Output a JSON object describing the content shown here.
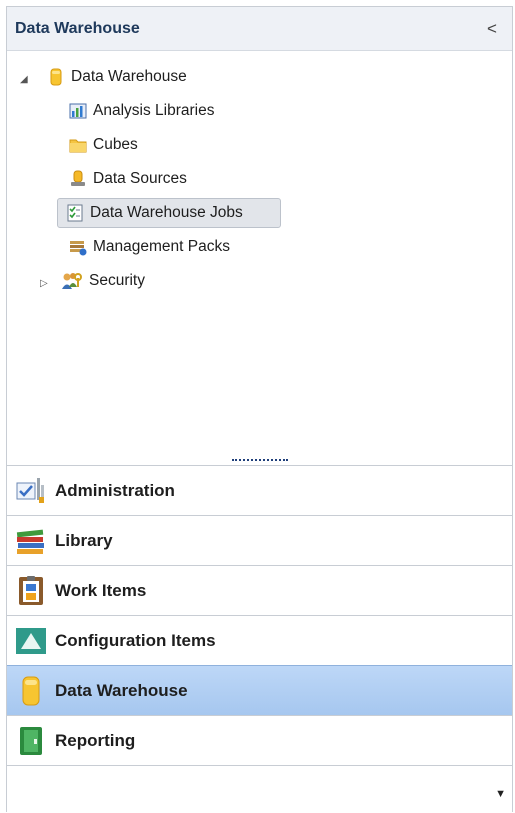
{
  "header": {
    "title": "Data Warehouse",
    "collapse_glyph": "<"
  },
  "tree": {
    "root": {
      "label": "Data Warehouse",
      "icon": "database-icon",
      "expanded": true,
      "twisty": "◢"
    },
    "children": [
      {
        "label": "Analysis Libraries",
        "icon": "chart-icon"
      },
      {
        "label": "Cubes",
        "icon": "folder-icon"
      },
      {
        "label": "Data Sources",
        "icon": "data-source-icon"
      },
      {
        "label": "Data Warehouse Jobs",
        "icon": "checklist-icon",
        "selected": true
      },
      {
        "label": "Management Packs",
        "icon": "management-pack-icon"
      },
      {
        "label": "Security",
        "icon": "users-key-icon",
        "expandable": true,
        "twisty": "▷"
      }
    ]
  },
  "nav": [
    {
      "label": "Administration",
      "icon": "admin-tools-icon"
    },
    {
      "label": "Library",
      "icon": "books-icon"
    },
    {
      "label": "Work Items",
      "icon": "clipboard-icon"
    },
    {
      "label": "Configuration Items",
      "icon": "config-item-icon"
    },
    {
      "label": "Data Warehouse",
      "icon": "database-icon",
      "active": true
    },
    {
      "label": "Reporting",
      "icon": "report-book-icon"
    }
  ],
  "footer": {
    "menu_glyph": "▼"
  },
  "colors": {
    "active_nav": "#b3d0f4",
    "header_text": "#1e395b",
    "selected_row": "#e2e5ea"
  }
}
